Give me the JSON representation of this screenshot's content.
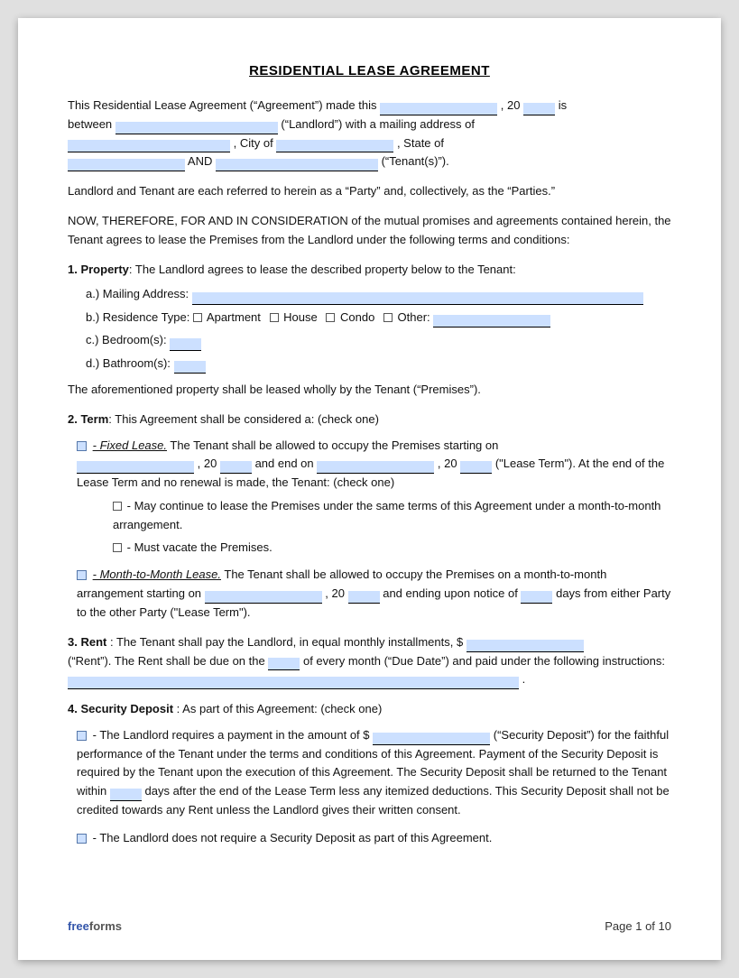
{
  "title": "RESIDENTIAL LEASE AGREEMENT",
  "intro": {
    "line1_pre": "This Residential Lease Agreement (“Agreement”) made this",
    "line1_mid": ", 20",
    "line1_post": "is",
    "line2_pre": "between",
    "line2_mid": "(“Landlord”) with a mailing address of",
    "line3_pre": "",
    "line3_city": ", City of",
    "line3_state": ", State of",
    "line4_and": "AND",
    "line4_post": "(“Tenant(s)”)."
  },
  "parties_text": "Landlord and Tenant are each referred to herein as a “Party” and, collectively, as the “Parties.”",
  "now_therefore": "NOW, THEREFORE, FOR AND IN CONSIDERATION of the mutual promises and agreements contained herein, the Tenant agrees to lease the Premises from the Landlord under the following terms and conditions:",
  "section1": {
    "heading": "1. Property",
    "intro": ": The Landlord agrees to lease the described property below to the Tenant:",
    "a_label": "a.)  Mailing Address:",
    "b_label": "b.)  Residence Type:",
    "b_apartment": "Apartment",
    "b_house": "House",
    "b_condo": "Condo",
    "b_other": "Other:",
    "c_label": "c.)  Bedroom(s):",
    "d_label": "d.)  Bathroom(s):",
    "closing": "The aforementioned property shall be leased wholly by the Tenant (“Premises”)."
  },
  "section2": {
    "heading": "2. Term",
    "intro": ": This Agreement shall be considered a: (check one)",
    "fixed_label": "- Fixed Lease.",
    "fixed_text1": "The Tenant shall be allowed to occupy the Premises starting on",
    "fixed_text2": ", 20",
    "fixed_text3": "and end on",
    "fixed_text4": ", 20",
    "fixed_text5": "(“Lease Term”). At the end of the Lease Term and no renewal is made, the Tenant: (check one)",
    "sub1_text": "- May continue to lease the Premises under the same terms of this Agreement under a month-to-month arrangement.",
    "sub2_text": "- Must vacate the Premises.",
    "month_label": "- Month-to-Month Lease.",
    "month_text1": "The Tenant shall be allowed to occupy the Premises on a month-to-month arrangement starting on",
    "month_text2": ", 20",
    "month_text3": "and ending upon notice of",
    "month_text4": "days from either Party to the other Party (“Lease Term”)."
  },
  "section3": {
    "heading": "3. Rent",
    "text1": ": The Tenant shall pay the Landlord, in equal monthly installments, $",
    "text2": "(“Rent”). The Rent shall be due on the",
    "text3": "of every month (“Due Date”) and paid under the following instructions:",
    "text4": "."
  },
  "section4": {
    "heading": "4. Security Deposit",
    "intro": ": As part of this Agreement: (check one)",
    "option1_text": "- The Landlord requires a payment in the amount of $",
    "option1_mid": "(“Security Deposit”) for the faithful performance of the Tenant under the terms and conditions of this Agreement. Payment of the Security Deposit is required by the Tenant upon the execution of this Agreement. The Security Deposit shall be returned to the Tenant within",
    "option1_days": "days after the end of the Lease Term less any itemized deductions. This Security Deposit shall not be credited towards any Rent unless the Landlord gives their written consent.",
    "option2_text": "- The Landlord does not require a Security Deposit as part of this Agreement."
  },
  "footer": {
    "free": "free",
    "forms": "forms",
    "page": "Page 1 of 10"
  }
}
